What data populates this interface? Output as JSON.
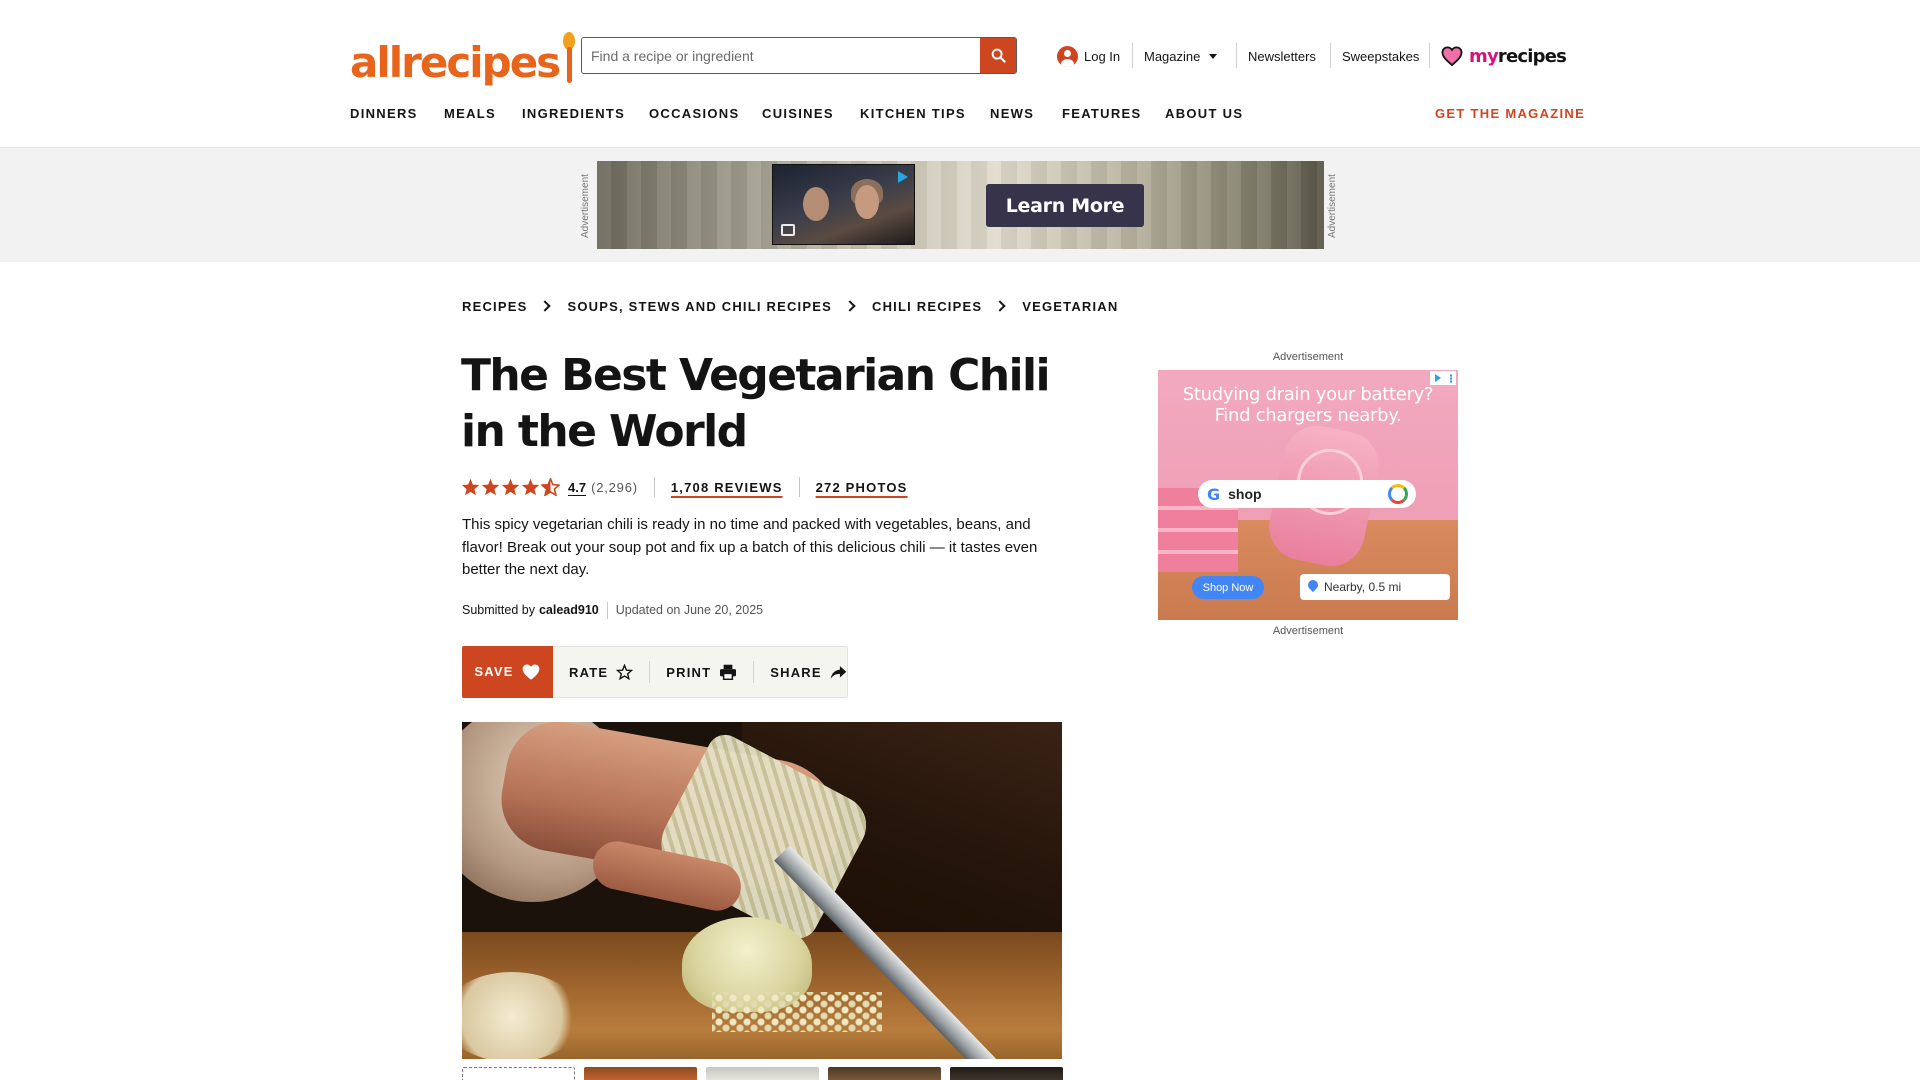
{
  "header": {
    "logo": "allrecipes",
    "search_placeholder": "Find a recipe or ingredient",
    "login": "Log In",
    "magazine": "Magazine",
    "newsletters": "Newsletters",
    "sweepstakes": "Sweepstakes",
    "myrecipes_my": "my",
    "myrecipes_recipes": "recipes"
  },
  "nav": {
    "items": [
      "DINNERS",
      "MEALS",
      "INGREDIENTS",
      "OCCASIONS",
      "CUISINES",
      "KITCHEN TIPS",
      "NEWS",
      "FEATURES",
      "ABOUT US"
    ],
    "cta": "GET THE MAGAZINE"
  },
  "top_ad": {
    "label": "Advertisement",
    "button": "Learn More"
  },
  "breadcrumbs": [
    "RECIPES",
    "SOUPS, STEWS AND CHILI RECIPES",
    "CHILI RECIPES",
    "VEGETARIAN"
  ],
  "recipe": {
    "title": "The Best Vegetarian Chili in the World",
    "rating": "4.7",
    "rating_value": 4.7,
    "rating_count": "(2,296)",
    "reviews": "1,708 REVIEWS",
    "photos": "272 PHOTOS",
    "description": "This spicy vegetarian chili is ready in no time and packed with vegetables, beans, and flavor! Break out your soup pot and fix up a batch of this delicious chili — it tastes even better the next day.",
    "submitted_by_label": "Submitted by",
    "author": "calead910",
    "updated": "Updated on June 20, 2025"
  },
  "actions": {
    "save": "SAVE",
    "rate": "RATE",
    "print": "PRINT",
    "share": "SHARE"
  },
  "side_ad": {
    "label_top": "Advertisement",
    "label_bottom": "Advertisement",
    "headline_1": "Studying drain your battery?",
    "headline_2": "Find chargers nearby.",
    "search_text": "shop",
    "shop_now": "Shop Now",
    "nearby": "Nearby, 0.5 mi"
  },
  "colors": {
    "brand_orange": "#ce4620",
    "logo_orange": "#e8641b",
    "myrecipes_pink": "#d4147b"
  }
}
